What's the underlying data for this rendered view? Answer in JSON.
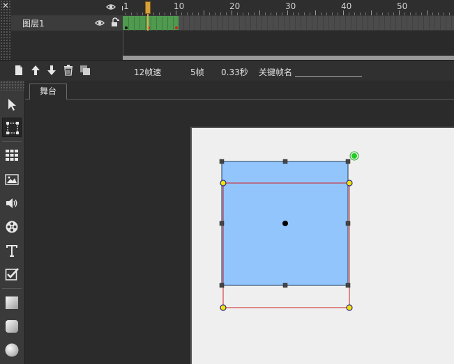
{
  "timeline": {
    "ruler_labels": [
      "1",
      "10",
      "20",
      "30",
      "40",
      "50"
    ],
    "layer": {
      "name": "图层1"
    },
    "toolbar": {
      "fps": "12帧速",
      "frame_count": "5帧",
      "duration": "0.33秒",
      "keyframe_label": "关键帧名",
      "keyframe_value": ""
    },
    "current_frame": 5
  },
  "stage": {
    "tab_label": "舞台"
  },
  "colors": {
    "shape_fill": "#93c5fd",
    "frame_green": "#4f9a4f",
    "playhead": "#d9a13a",
    "bbox_red": "#d02020",
    "handle_yellow": "#f5e400",
    "rotate_green": "#22cc22"
  },
  "tools": [
    "selection-arrow-icon",
    "transform-icon",
    "grid-icon",
    "image-icon",
    "sound-icon",
    "film-reel-icon",
    "text-icon",
    "checkbox-icon",
    "rectangle-icon",
    "rounded-rectangle-icon",
    "circle-icon"
  ]
}
